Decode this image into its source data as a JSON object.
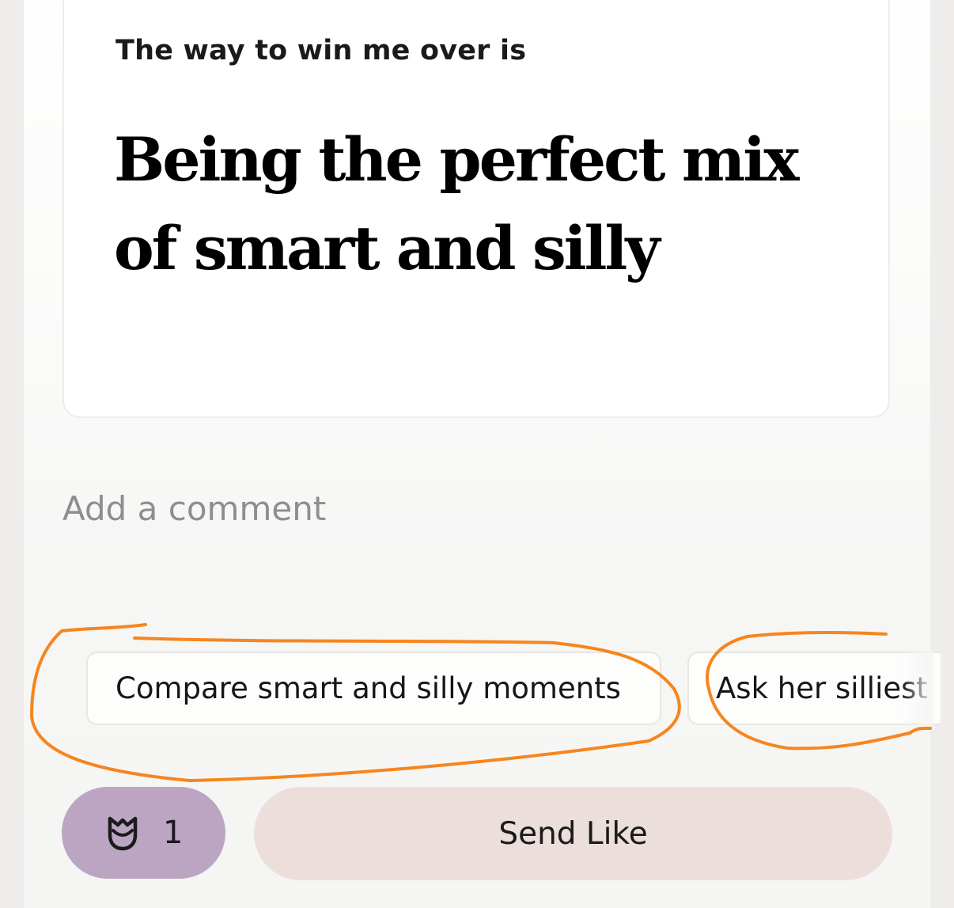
{
  "prompt": {
    "label": "The way to win me over is",
    "answer": "Being the perfect mix of smart and silly"
  },
  "comment": {
    "placeholder": "Add a comment",
    "value": ""
  },
  "suggestions": [
    {
      "label": "Compare smart and silly moments"
    },
    {
      "label": "Ask her silliest"
    }
  ],
  "actions": {
    "rose_icon": "rose-icon",
    "rose_count": "1",
    "send_label": "Send Like"
  },
  "colors": {
    "annotation": "#f7851e",
    "rose_button_bg": "#bca5c2",
    "send_button_bg": "#ecdfdb"
  }
}
